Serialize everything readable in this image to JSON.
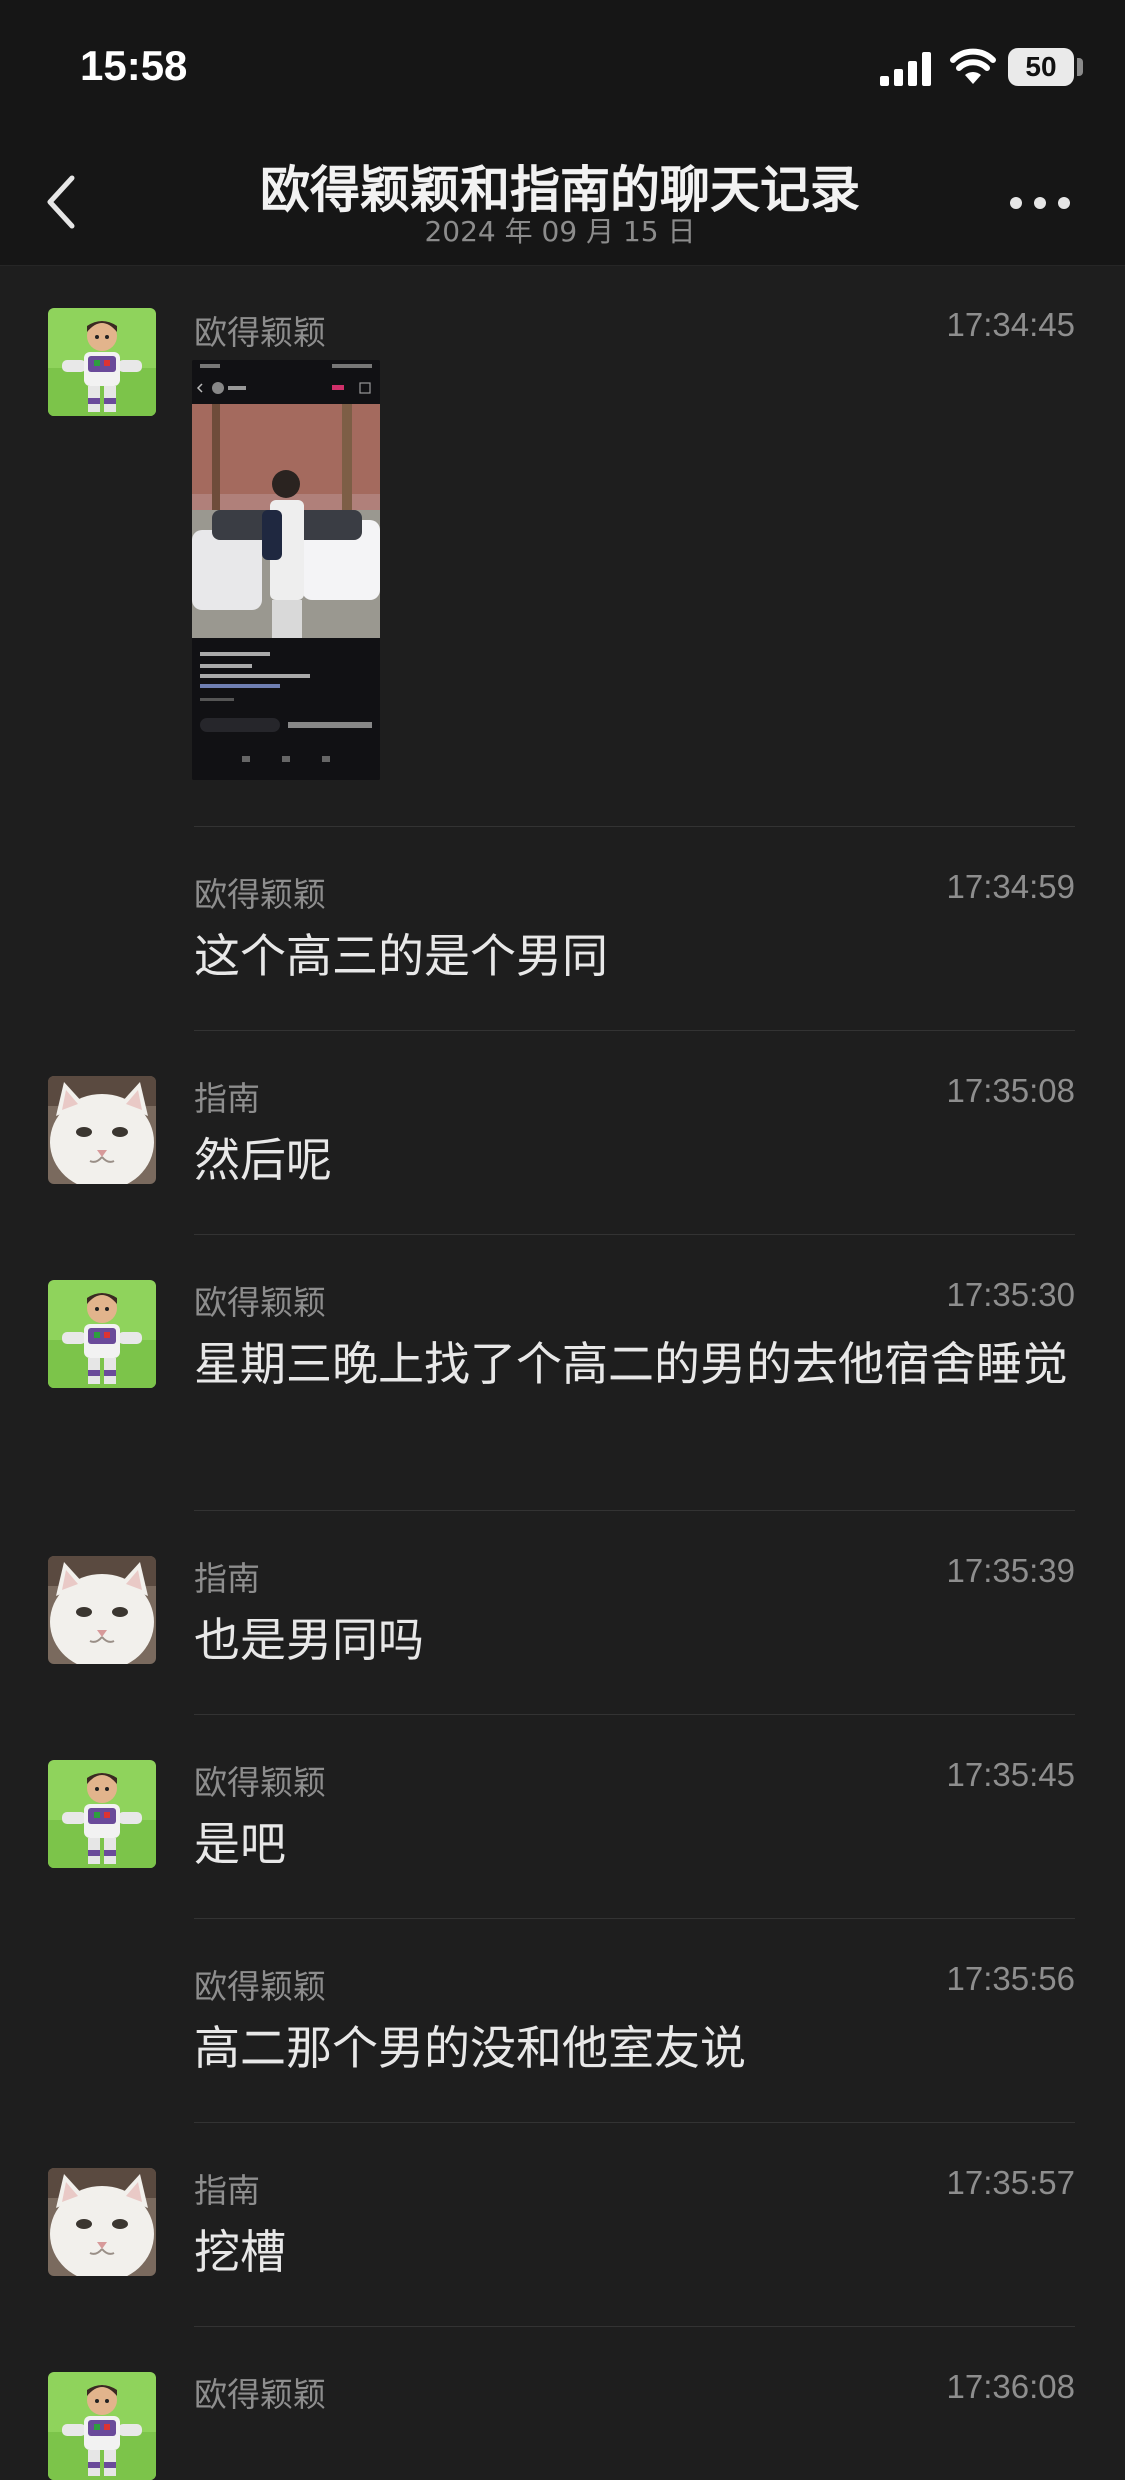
{
  "status_bar": {
    "time": "15:58",
    "battery": "50"
  },
  "nav": {
    "title": "欧得颖颖和指南的聊天记录",
    "date": "2024 年 09 月 15 日"
  },
  "messages": [
    {
      "sender": "欧得颖颖",
      "time": "17:34:45",
      "type": "image",
      "text": ""
    },
    {
      "sender": "欧得颖颖",
      "time": "17:34:59",
      "type": "text",
      "text": "这个高三的是个男同"
    },
    {
      "sender": "指南",
      "time": "17:35:08",
      "type": "text",
      "text": "然后呢"
    },
    {
      "sender": "欧得颖颖",
      "time": "17:35:30",
      "type": "text",
      "text": "星期三晚上找了个高二的男的去他宿舍睡觉"
    },
    {
      "sender": "指南",
      "time": "17:35:39",
      "type": "text",
      "text": "也是男同吗"
    },
    {
      "sender": "欧得颖颖",
      "time": "17:35:45",
      "type": "text",
      "text": "是吧"
    },
    {
      "sender": "欧得颖颖",
      "time": "17:35:56",
      "type": "text",
      "text": "高二那个男的没和他室友说"
    },
    {
      "sender": "指南",
      "time": "17:35:57",
      "type": "text",
      "text": "挖槽"
    },
    {
      "sender": "欧得颖颖",
      "time": "17:36:08",
      "type": "text",
      "text": ""
    }
  ],
  "colors": {
    "background": "#1e1e1e",
    "header": "#161616",
    "secondary_text": "#8e8e8e",
    "primary_text": "#e8e8e8"
  }
}
